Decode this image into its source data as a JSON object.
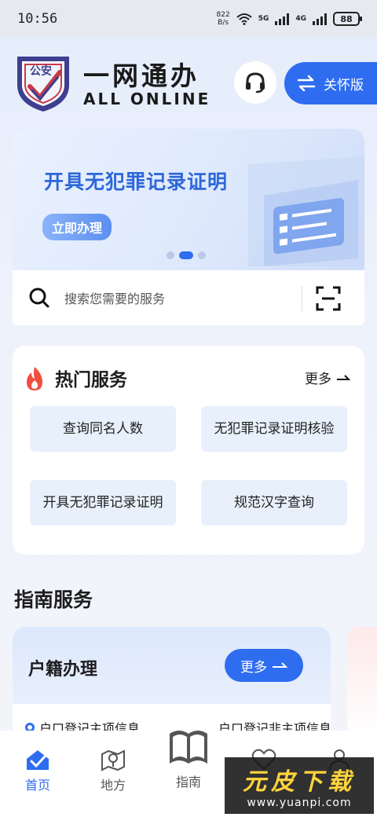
{
  "status_bar": {
    "time": "10:56",
    "net_speed_value": "822",
    "net_speed_unit": "B/s",
    "net1": "5G",
    "net2": "4G",
    "battery": "88"
  },
  "header": {
    "badge": "公安",
    "title": "一网通办",
    "subtitle": "ALL ONLINE",
    "care_label": "关怀版"
  },
  "banner": {
    "title": "开具无犯罪记录证明",
    "button": "立即办理",
    "slide_count": 3,
    "active_slide": 2
  },
  "search": {
    "placeholder": "搜索您需要的服务"
  },
  "hot_services": {
    "title": "热门服务",
    "more": "更多",
    "items": [
      {
        "label": "查询同名人数"
      },
      {
        "label": "无犯罪记录证明核验"
      },
      {
        "label": "开具无犯罪记录证明"
      },
      {
        "label": "规范汉字查询"
      }
    ]
  },
  "guide": {
    "title": "指南服务",
    "card_title": "户籍办理",
    "card_more": "更多",
    "items": [
      {
        "label": "户口登记主项信息"
      },
      {
        "label": "户口登记非主项信息"
      }
    ]
  },
  "tabs": [
    {
      "label": "首页"
    },
    {
      "label": "地方"
    },
    {
      "label": "指南"
    },
    {
      "label": ""
    },
    {
      "label": ""
    }
  ],
  "watermark": {
    "big": "元皮下载",
    "small": "www.yuanpi.com"
  },
  "colors": {
    "accent": "#2f6df0",
    "banner_text": "#2d67d8",
    "tile_bg": "#e8f0fb"
  }
}
